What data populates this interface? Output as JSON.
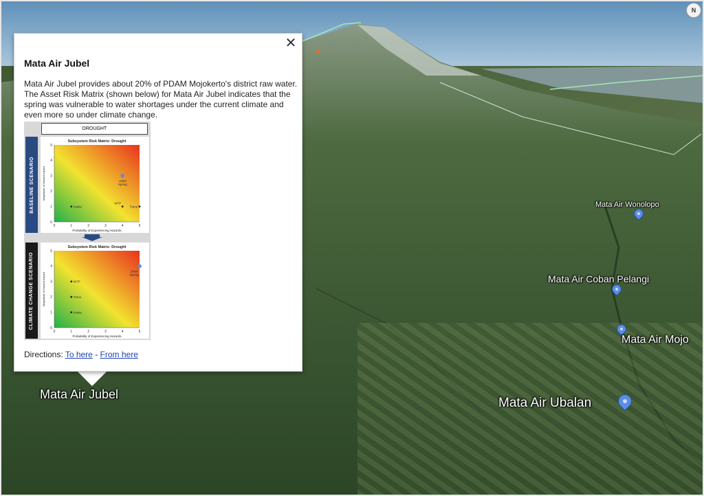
{
  "map": {
    "compass_label": "N",
    "places": {
      "jubel": "Mata Air Jubel",
      "wonolopo": "Mata Air Wonolopo",
      "coban_pelangi": "Mata Air Coban Pelangi",
      "mojo": "Mata Air Mojo",
      "ubalan": "Mata Air Ubalan"
    },
    "colors": {
      "pin": "#5b8de0",
      "pin_border": "#234f9e",
      "route_line": "#a8e6b8"
    }
  },
  "balloon": {
    "close_label": "✕",
    "title": "Mata Air Jubel",
    "description": "Mata Air Jubel provides about 20% of PDAM Mojokerto's district raw water. The Asset Risk Matrix (shown below) for Mata Air Jubel indicates that the spring was vulnerable to water shortages under the current climate and even more so under climate change.",
    "directions_label": "Directions:",
    "to_here": "To here",
    "separator": "-",
    "from_here": "From here"
  },
  "figure": {
    "header": "DROUGHT",
    "baseline_label": "BASELINE SCENARIO",
    "climate_label": "CLIMATE CHANGE SCENARIO",
    "colors": {
      "baseline_bar": "#2a4a82",
      "climate_bar": "#1a1a1a",
      "arrow": "#2a4a82"
    }
  },
  "chart_data": [
    {
      "type": "scatter",
      "title": "Subsystem Risk Matrix: Drought",
      "xlabel": "Probability of Experiencing Hazards",
      "ylabel": "Magnitude of Hazard Impact",
      "xlim": [
        0,
        5
      ],
      "ylim": [
        0,
        5
      ],
      "xticks": [
        "0",
        "1",
        "2",
        "3",
        "4",
        "5"
      ],
      "yticks": [
        "0",
        "1",
        "2",
        "3",
        "4",
        "5"
      ],
      "points": [
        {
          "label": "Intake",
          "x": 1,
          "y": 1,
          "color": "#222222"
        },
        {
          "label": "WTP",
          "x": 4,
          "y": 1,
          "color": "#222222"
        },
        {
          "label": "Trans",
          "x": 5,
          "y": 1,
          "color": "#222222"
        },
        {
          "label": "Jobel Spring",
          "x": 4,
          "y": 3,
          "color": "#5b8de0"
        }
      ]
    },
    {
      "type": "scatter",
      "title": "Subsystem Risk Matrix: Drought",
      "xlabel": "Probability of Experiencing Hazards",
      "ylabel": "Magnitude of Hazard Impact",
      "xlim": [
        0,
        5
      ],
      "ylim": [
        0,
        5
      ],
      "xticks": [
        "0",
        "1",
        "2",
        "3",
        "4",
        "5"
      ],
      "yticks": [
        "0",
        "1",
        "2",
        "3",
        "4",
        "5"
      ],
      "points": [
        {
          "label": "WTP",
          "x": 1,
          "y": 3,
          "color": "#222222"
        },
        {
          "label": "Trans",
          "x": 1,
          "y": 2,
          "color": "#222222"
        },
        {
          "label": "Intake",
          "x": 1,
          "y": 1,
          "color": "#222222"
        },
        {
          "label": "Jobel Spring",
          "x": 5,
          "y": 4,
          "color": "#5b8de0"
        }
      ]
    }
  ]
}
